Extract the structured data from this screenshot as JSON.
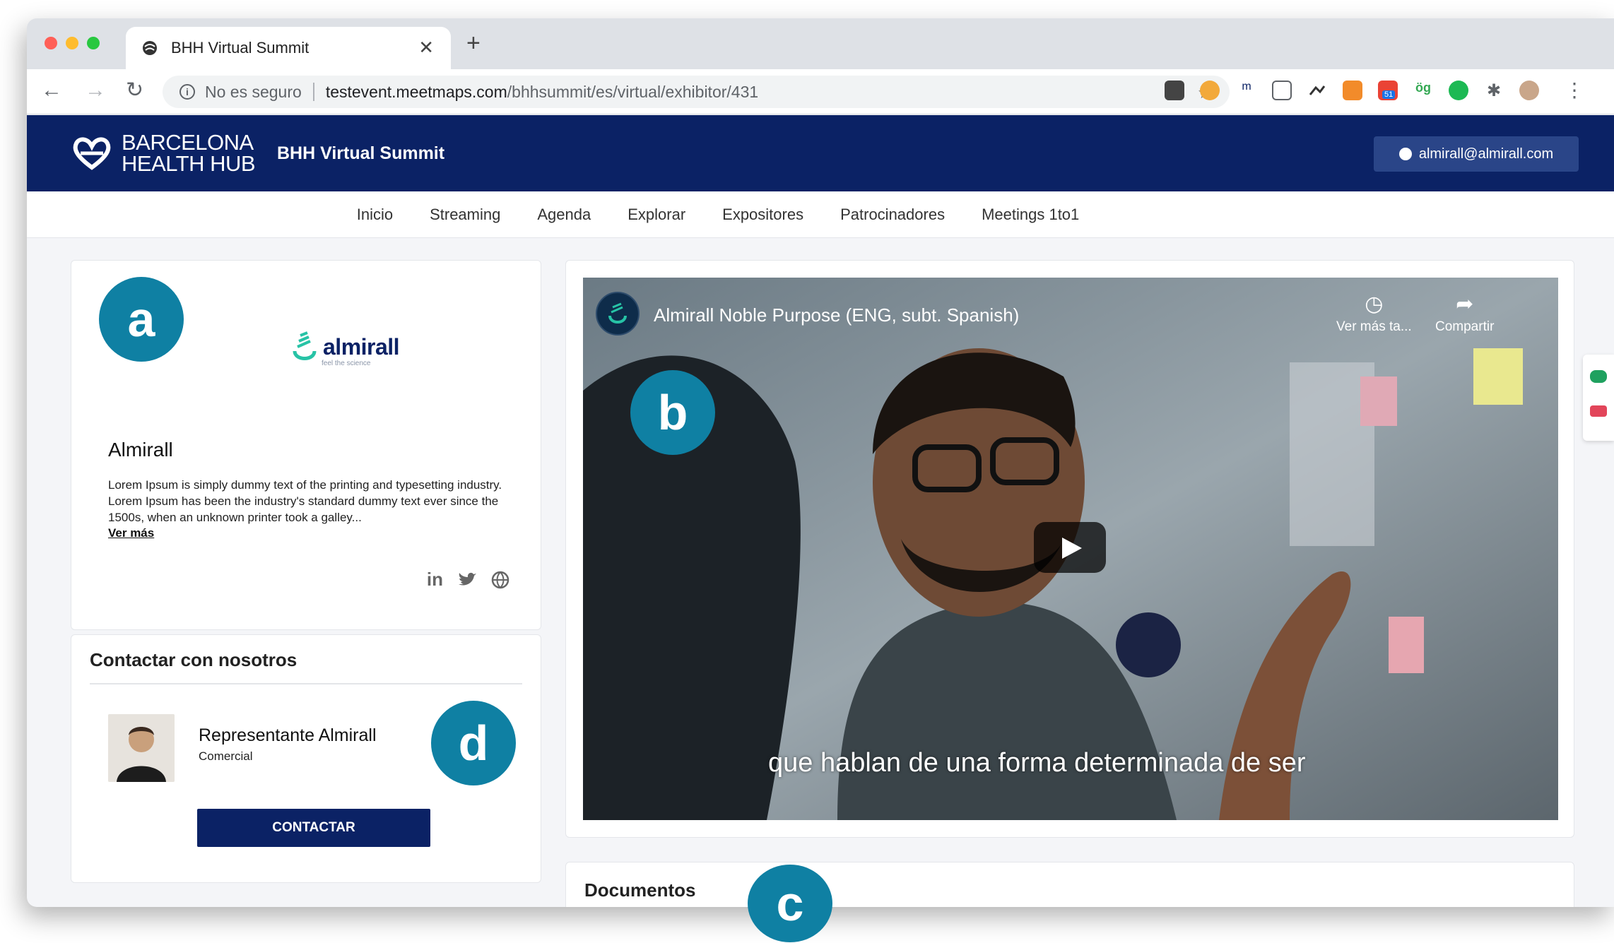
{
  "browser": {
    "tab_title": "BHH Virtual Summit",
    "tab_close": "✕",
    "new_tab": "+",
    "not_secure": "No es seguro",
    "url_host": "testevent.meetmaps.com",
    "url_path": "/bhhsummit/es/virtual/exhibitor/431",
    "extension_badge": "51"
  },
  "header": {
    "brand_line1": "BARCELONA",
    "brand_line2": "HEALTH HUB",
    "app_title": "BHH Virtual Summit",
    "user_email": "almirall@almirall.com"
  },
  "nav": {
    "items": [
      "Inicio",
      "Streaming",
      "Agenda",
      "Explorar",
      "Expositores",
      "Patrocinadores",
      "Meetings 1to1"
    ]
  },
  "exhibitor": {
    "logo_text": "almirall",
    "logo_tagline": "feel the science",
    "name": "Almirall",
    "description": "Lorem Ipsum is simply dummy text of the printing and typesetting industry. Lorem Ipsum has been the industry's standard dummy text ever since the 1500s, when an unknown printer took a galley...",
    "more_link": "Ver más",
    "social": [
      "in",
      "twitter",
      "web"
    ]
  },
  "contact": {
    "title": "Contactar con nosotros",
    "rep_name": "Representante Almirall",
    "rep_role": "Comercial",
    "button": "CONTACTAR"
  },
  "video": {
    "title": "Almirall Noble Purpose (ENG, subt. Spanish)",
    "watch_later": "Ver más ta...",
    "share": "Compartir",
    "subtitle": "que hablan de una forma determinada de ser"
  },
  "documents": {
    "title": "Documentos"
  },
  "annotations": [
    "a",
    "b",
    "c",
    "d"
  ],
  "colors": {
    "header_bg": "#0b2265",
    "annotation": "#0f80a3",
    "brand_green": "#27c3a6"
  }
}
